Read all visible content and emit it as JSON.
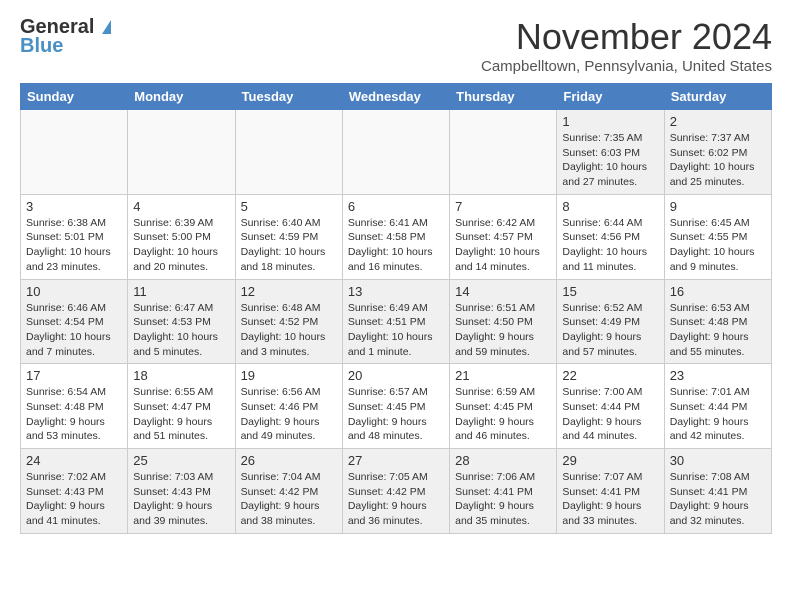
{
  "header": {
    "logo_line1": "General",
    "logo_line2": "Blue",
    "month": "November 2024",
    "location": "Campbelltown, Pennsylvania, United States"
  },
  "days_of_week": [
    "Sunday",
    "Monday",
    "Tuesday",
    "Wednesday",
    "Thursday",
    "Friday",
    "Saturday"
  ],
  "weeks": [
    [
      {
        "day": "",
        "info": "",
        "empty": true
      },
      {
        "day": "",
        "info": "",
        "empty": true
      },
      {
        "day": "",
        "info": "",
        "empty": true
      },
      {
        "day": "",
        "info": "",
        "empty": true
      },
      {
        "day": "",
        "info": "",
        "empty": true
      },
      {
        "day": "1",
        "info": "Sunrise: 7:35 AM\nSunset: 6:03 PM\nDaylight: 10 hours\nand 27 minutes.",
        "empty": false
      },
      {
        "day": "2",
        "info": "Sunrise: 7:37 AM\nSunset: 6:02 PM\nDaylight: 10 hours\nand 25 minutes.",
        "empty": false
      }
    ],
    [
      {
        "day": "3",
        "info": "Sunrise: 6:38 AM\nSunset: 5:01 PM\nDaylight: 10 hours\nand 23 minutes.",
        "empty": false
      },
      {
        "day": "4",
        "info": "Sunrise: 6:39 AM\nSunset: 5:00 PM\nDaylight: 10 hours\nand 20 minutes.",
        "empty": false
      },
      {
        "day": "5",
        "info": "Sunrise: 6:40 AM\nSunset: 4:59 PM\nDaylight: 10 hours\nand 18 minutes.",
        "empty": false
      },
      {
        "day": "6",
        "info": "Sunrise: 6:41 AM\nSunset: 4:58 PM\nDaylight: 10 hours\nand 16 minutes.",
        "empty": false
      },
      {
        "day": "7",
        "info": "Sunrise: 6:42 AM\nSunset: 4:57 PM\nDaylight: 10 hours\nand 14 minutes.",
        "empty": false
      },
      {
        "day": "8",
        "info": "Sunrise: 6:44 AM\nSunset: 4:56 PM\nDaylight: 10 hours\nand 11 minutes.",
        "empty": false
      },
      {
        "day": "9",
        "info": "Sunrise: 6:45 AM\nSunset: 4:55 PM\nDaylight: 10 hours\nand 9 minutes.",
        "empty": false
      }
    ],
    [
      {
        "day": "10",
        "info": "Sunrise: 6:46 AM\nSunset: 4:54 PM\nDaylight: 10 hours\nand 7 minutes.",
        "empty": false
      },
      {
        "day": "11",
        "info": "Sunrise: 6:47 AM\nSunset: 4:53 PM\nDaylight: 10 hours\nand 5 minutes.",
        "empty": false
      },
      {
        "day": "12",
        "info": "Sunrise: 6:48 AM\nSunset: 4:52 PM\nDaylight: 10 hours\nand 3 minutes.",
        "empty": false
      },
      {
        "day": "13",
        "info": "Sunrise: 6:49 AM\nSunset: 4:51 PM\nDaylight: 10 hours\nand 1 minute.",
        "empty": false
      },
      {
        "day": "14",
        "info": "Sunrise: 6:51 AM\nSunset: 4:50 PM\nDaylight: 9 hours\nand 59 minutes.",
        "empty": false
      },
      {
        "day": "15",
        "info": "Sunrise: 6:52 AM\nSunset: 4:49 PM\nDaylight: 9 hours\nand 57 minutes.",
        "empty": false
      },
      {
        "day": "16",
        "info": "Sunrise: 6:53 AM\nSunset: 4:48 PM\nDaylight: 9 hours\nand 55 minutes.",
        "empty": false
      }
    ],
    [
      {
        "day": "17",
        "info": "Sunrise: 6:54 AM\nSunset: 4:48 PM\nDaylight: 9 hours\nand 53 minutes.",
        "empty": false
      },
      {
        "day": "18",
        "info": "Sunrise: 6:55 AM\nSunset: 4:47 PM\nDaylight: 9 hours\nand 51 minutes.",
        "empty": false
      },
      {
        "day": "19",
        "info": "Sunrise: 6:56 AM\nSunset: 4:46 PM\nDaylight: 9 hours\nand 49 minutes.",
        "empty": false
      },
      {
        "day": "20",
        "info": "Sunrise: 6:57 AM\nSunset: 4:45 PM\nDaylight: 9 hours\nand 48 minutes.",
        "empty": false
      },
      {
        "day": "21",
        "info": "Sunrise: 6:59 AM\nSunset: 4:45 PM\nDaylight: 9 hours\nand 46 minutes.",
        "empty": false
      },
      {
        "day": "22",
        "info": "Sunrise: 7:00 AM\nSunset: 4:44 PM\nDaylight: 9 hours\nand 44 minutes.",
        "empty": false
      },
      {
        "day": "23",
        "info": "Sunrise: 7:01 AM\nSunset: 4:44 PM\nDaylight: 9 hours\nand 42 minutes.",
        "empty": false
      }
    ],
    [
      {
        "day": "24",
        "info": "Sunrise: 7:02 AM\nSunset: 4:43 PM\nDaylight: 9 hours\nand 41 minutes.",
        "empty": false
      },
      {
        "day": "25",
        "info": "Sunrise: 7:03 AM\nSunset: 4:43 PM\nDaylight: 9 hours\nand 39 minutes.",
        "empty": false
      },
      {
        "day": "26",
        "info": "Sunrise: 7:04 AM\nSunset: 4:42 PM\nDaylight: 9 hours\nand 38 minutes.",
        "empty": false
      },
      {
        "day": "27",
        "info": "Sunrise: 7:05 AM\nSunset: 4:42 PM\nDaylight: 9 hours\nand 36 minutes.",
        "empty": false
      },
      {
        "day": "28",
        "info": "Sunrise: 7:06 AM\nSunset: 4:41 PM\nDaylight: 9 hours\nand 35 minutes.",
        "empty": false
      },
      {
        "day": "29",
        "info": "Sunrise: 7:07 AM\nSunset: 4:41 PM\nDaylight: 9 hours\nand 33 minutes.",
        "empty": false
      },
      {
        "day": "30",
        "info": "Sunrise: 7:08 AM\nSunset: 4:41 PM\nDaylight: 9 hours\nand 32 minutes.",
        "empty": false
      }
    ]
  ]
}
